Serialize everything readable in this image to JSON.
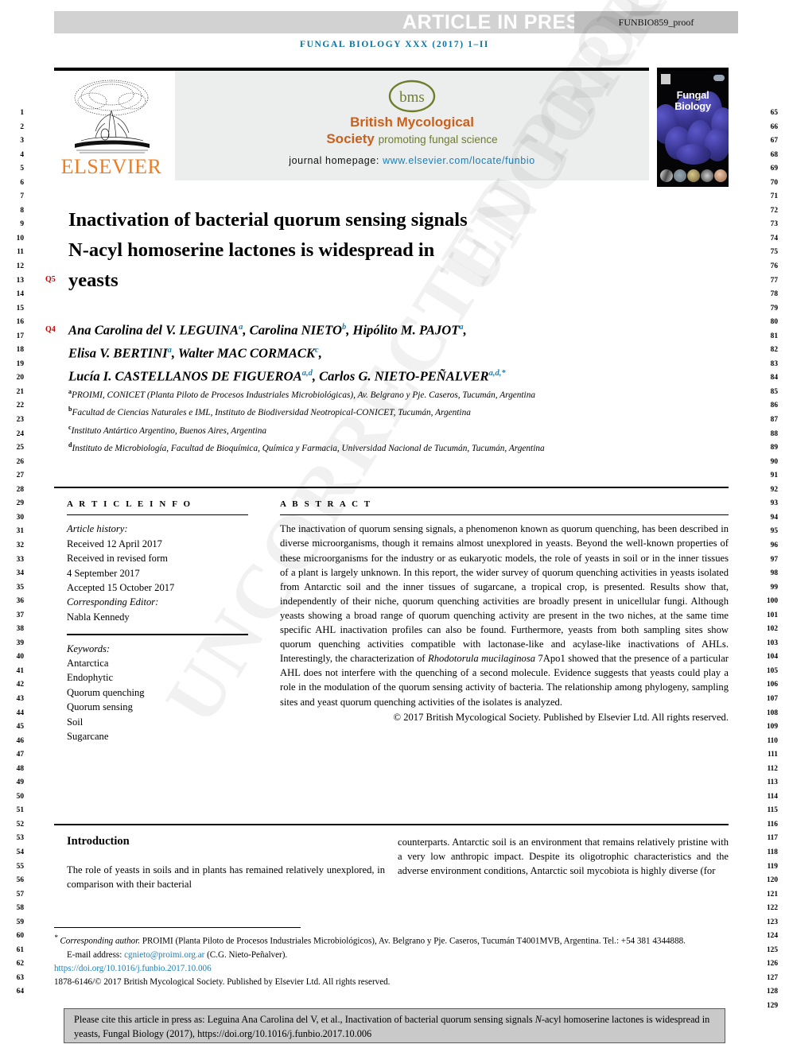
{
  "header": {
    "article_in_press": "ARTICLE IN PRESS",
    "proof_id": "FUNBIO859_proof",
    "journal_citation": "FUNGAL BIOLOGY XXX (2017) 1–II"
  },
  "masthead": {
    "publisher_name": "ELSEVIER",
    "society_logo_text": "bms",
    "society_name_line1": "British Mycological",
    "society_name_line2": "Society",
    "society_tagline": "promoting fungal science",
    "homepage_label": "journal homepage:",
    "homepage_url": "www.elsevier.com/locate/funbio",
    "cover_title_line1": "Fungal",
    "cover_title_line2": "Biology"
  },
  "article": {
    "title_line1": "Inactivation of bacterial quorum sensing signals",
    "title_line2": "N-acyl homoserine lactones is widespread in",
    "title_line3": "yeasts",
    "query_tag_title": "Q5",
    "query_tag_authors": "Q4",
    "authors_line1": "Ana Carolina del V. LEGUINA",
    "authors_line1_sup1": "a",
    "authors_line1_b": "Carolina NIETO",
    "authors_line1_sup2": "b",
    "authors_line1_c": "Hipólito M. PAJOT",
    "authors_line1_sup3": "a",
    "authors_line2_a": "Elisa V. BERTINI",
    "authors_line2_sup1": "a",
    "authors_line2_b": "Walter MAC CORMACK",
    "authors_line2_sup2": "c",
    "authors_line3_a": "Lucía I. CASTELLANOS DE FIGUEROA",
    "authors_line3_sup1": "a,d",
    "authors_line3_b": "Carlos G. NIETO-PEÑALVER",
    "authors_line3_sup2": "a,d,*",
    "affiliation_a_sup": "a",
    "affiliation_a": "PROIMI, CONICET (Planta Piloto de Procesos Industriales Microbiológicas), Av. Belgrano y Pje. Caseros, Tucumán, Argentina",
    "affiliation_b_sup": "b",
    "affiliation_b": "Facultad de Ciencias Naturales e IML, Instituto de Biodiversidad Neotropical-CONICET, Tucumán, Argentina",
    "affiliation_c_sup": "c",
    "affiliation_c": "Instituto Antártico Argentino, Buenos Aires, Argentina",
    "affiliation_d_sup": "d",
    "affiliation_d": "Instituto de Microbiología, Facultad de Bioquímica, Química y Farmacia, Universidad Nacional de Tucumán, Tucumán, Argentina"
  },
  "article_info": {
    "heading": "A R T I C L E   I N F O",
    "history_label": "Article history:",
    "received": "Received 12 April 2017",
    "revised_label": "Received in revised form",
    "revised_date": "4 September 2017",
    "accepted": "Accepted 15 October 2017",
    "editor_label": "Corresponding Editor:",
    "editor_name": "Nabla Kennedy",
    "keywords_label": "Keywords:",
    "keywords": [
      "Antarctica",
      "Endophytic",
      "Quorum quenching",
      "Quorum sensing",
      "Soil",
      "Sugarcane"
    ]
  },
  "abstract": {
    "heading": "A B S T R A C T",
    "text_part1": "The inactivation of quorum sensing signals, a phenomenon known as quorum quenching, has been described in diverse microorganisms, though it remains almost unexplored in yeasts. Beyond the well-known properties of these microorganisms for the industry or as eukaryotic models, the role of yeasts in soil or in the inner tissues of a plant is largely unknown. In this report, the wider survey of quorum quenching activities in yeasts isolated from Antarctic soil and the inner tissues of sugarcane, a tropical crop, is presented. Results show that, independently of their niche, quorum quenching activities are broadly present in unicellular fungi. Although yeasts showing a broad range of quorum quenching activity are present in the two niches, at the same time specific AHL inactivation profiles can also be found. Furthermore, yeasts from both sampling sites show quorum quenching activities compatible with lactonase-like and acylase-like inactivations of AHLs. Interestingly, the characterization of ",
    "species_italic": "Rhodotorula mucilaginosa",
    "text_part2": " 7Apo1 showed that the presence of a particular AHL does not interfere with the quenching of a second molecule. Evidence suggests that yeasts could play a role in the modulation of the quorum sensing activity of bacteria. The relationship among phylogeny, sampling sites and yeast quorum quenching activities of the isolates is analyzed.",
    "rights": "© 2017 British Mycological Society. Published by Elsevier Ltd. All rights reserved."
  },
  "introduction": {
    "heading": "Introduction",
    "col_left": "The role of yeasts in soils and in plants has remained relatively unexplored, in comparison with their bacterial",
    "col_right": "counterparts. Antarctic soil is an environment that remains relatively pristine with a very low anthropic impact. Despite its oligotrophic characteristics and the adverse environment conditions, Antarctic soil mycobiota is highly diverse (for"
  },
  "footnotes": {
    "corr_marker": "*",
    "corr_italic": "Corresponding author.",
    "corr_text": " PROIMI (Planta Piloto de Procesos Industriales Microbiológicos), Av. Belgrano y Pje. Caseros, Tucumán T4001MVB, Argentina. Tel.: +54 381 4344888.",
    "email_label": "E-mail address:",
    "email": "cgnieto@proimi.org.ar",
    "email_owner": "(C.G. Nieto-Peñalver).",
    "doi": "https://doi.org/10.1016/j.funbio.2017.10.006",
    "issn_line": "1878-6146/© 2017 British Mycological Society. Published by Elsevier Ltd. All rights reserved."
  },
  "citation_box": {
    "prefix": "Please cite this article in press as: Leguina Ana Carolina del V, et al., Inactivation of bacterial quorum sensing signals ",
    "italic_part": "N",
    "suffix": "-acyl homoserine lactones is widespread in yeasts, Fungal Biology (2017), https://doi.org/10.1016/j.funbio.2017.10.006"
  },
  "watermark": {
    "text": "UNCORRECTED PROOF"
  },
  "line_numbers": {
    "left_start": 1,
    "left_end": 64,
    "right_start": 65,
    "right_end": 129
  },
  "colors": {
    "journal_blue": "#0a72a0",
    "link_blue": "#1a7fb5",
    "elsevier_orange": "#ef7d21",
    "bms_orange": "#c9601c",
    "bms_green": "#6f7d2a",
    "query_red": "#cc0000",
    "press_bar": "#d2d2d2",
    "proof_bar": "#bfbfbf",
    "cite_box": "#c9c9c9"
  }
}
